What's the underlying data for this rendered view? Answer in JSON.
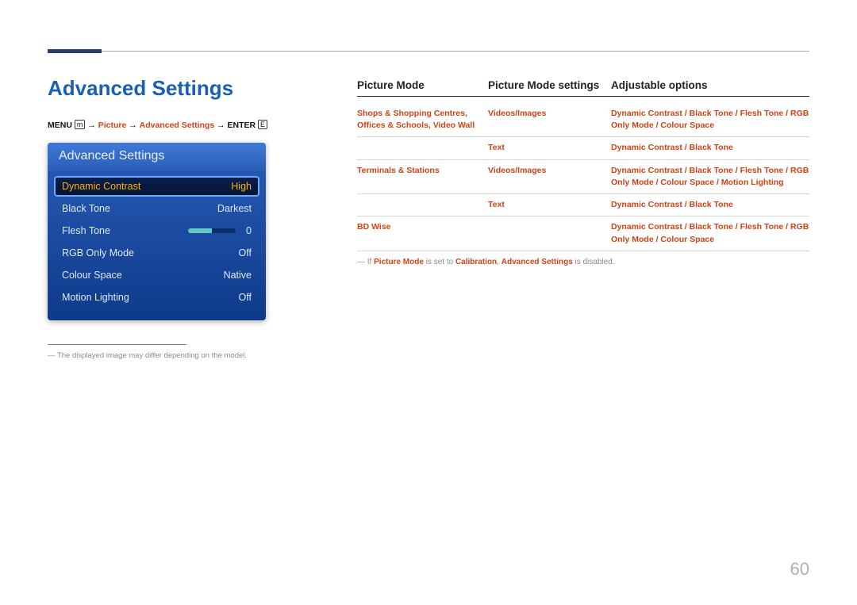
{
  "page": {
    "title": "Advanced Settings",
    "page_number": "60"
  },
  "breadcrumb": {
    "prefix": "MENU",
    "icon1": "m",
    "seg1": "Picture",
    "seg2": "Advanced Settings",
    "suffix": "ENTER",
    "icon2": "E"
  },
  "osd": {
    "title": "Advanced Settings",
    "rows": [
      {
        "label": "Dynamic Contrast",
        "value": "High",
        "selected": true
      },
      {
        "label": "Black Tone",
        "value": "Darkest"
      },
      {
        "label": "Flesh Tone",
        "value": "0",
        "slider": true
      },
      {
        "label": "RGB Only Mode",
        "value": "Off"
      },
      {
        "label": "Colour Space",
        "value": "Native"
      },
      {
        "label": "Motion Lighting",
        "value": "Off"
      }
    ]
  },
  "footnote_left": "The displayed image may differ depending on the model.",
  "table": {
    "head": {
      "c1": "Picture Mode",
      "c2": "Picture Mode settings",
      "c3": "Adjustable options"
    },
    "rows": [
      {
        "c1": "Shops & Shopping Centres, Offices & Schools, Video Wall",
        "c2": "Videos/Images",
        "c3": "Dynamic Contrast / Black Tone / Flesh Tone / RGB Only Mode / Colour Space"
      },
      {
        "c1": "",
        "c2": "Text",
        "c3": "Dynamic Contrast / Black Tone"
      },
      {
        "c1": "Terminals & Stations",
        "c2": "Videos/Images",
        "c3": "Dynamic Contrast / Black Tone / Flesh Tone / RGB Only Mode / Colour Space / Motion Lighting"
      },
      {
        "c1": "",
        "c2": "Text",
        "c3": "Dynamic Contrast / Black Tone"
      },
      {
        "c1": "BD Wise",
        "c2": "",
        "c3": "Dynamic Contrast / Black Tone / Flesh Tone / RGB Only Mode / Colour Space"
      }
    ]
  },
  "note_below": {
    "pre": "If ",
    "b1": "Picture Mode",
    "mid1": " is set to ",
    "b2": "Calibration",
    "mid2": ", ",
    "b3": "Advanced Settings",
    "post": " is disabled."
  }
}
